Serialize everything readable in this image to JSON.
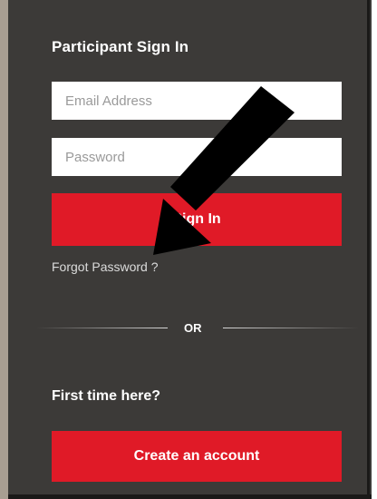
{
  "signin": {
    "title": "Participant Sign In",
    "email_placeholder": "Email Address",
    "email_value": "",
    "password_placeholder": "Password",
    "password_value": "",
    "signin_button_label": "Sign In",
    "forgot_password_label": "Forgot Password ?"
  },
  "divider": {
    "or_label": "OR"
  },
  "signup": {
    "prompt": "First time here?",
    "create_button_label": "Create an account"
  },
  "colors": {
    "panel_bg": "#3c3a38",
    "accent_red": "#e01a27",
    "annotation_arrow": "#000000"
  },
  "icons": {
    "annotation": "arrow-pointing-to-forgot-password"
  }
}
